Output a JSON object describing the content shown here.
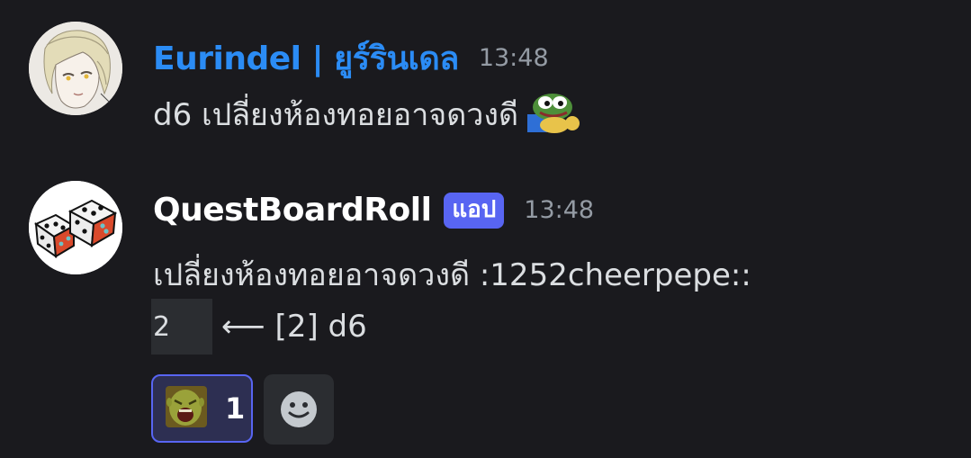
{
  "messages": [
    {
      "author": "Eurindel | ยูร์รินเดล",
      "author_color": "#2b8cf5",
      "timestamp": "13:48",
      "text": "d6 เปลี่ยงห้องทอยอาจดวงดี",
      "avatar_icon": "anime-character-avatar",
      "inline_emoji": "pepe-cheer-emoji"
    },
    {
      "author": "QuestBoardRoll",
      "author_color": "#ffffff",
      "badge": "แอป",
      "badge_color": "#5865f2",
      "timestamp": "13:48",
      "text": "เปลี่ยงห้องทอยอาจดวงดี :1252cheerpepe::",
      "avatar_icon": "dice-avatar",
      "roll": {
        "value": "2",
        "result_text": "⟵ [2] d6"
      },
      "reactions": [
        {
          "emoji": "shrek-scream-emoji",
          "count": "1",
          "active": true
        }
      ],
      "add_reaction_icon": "smiley-add-reaction-icon"
    }
  ]
}
